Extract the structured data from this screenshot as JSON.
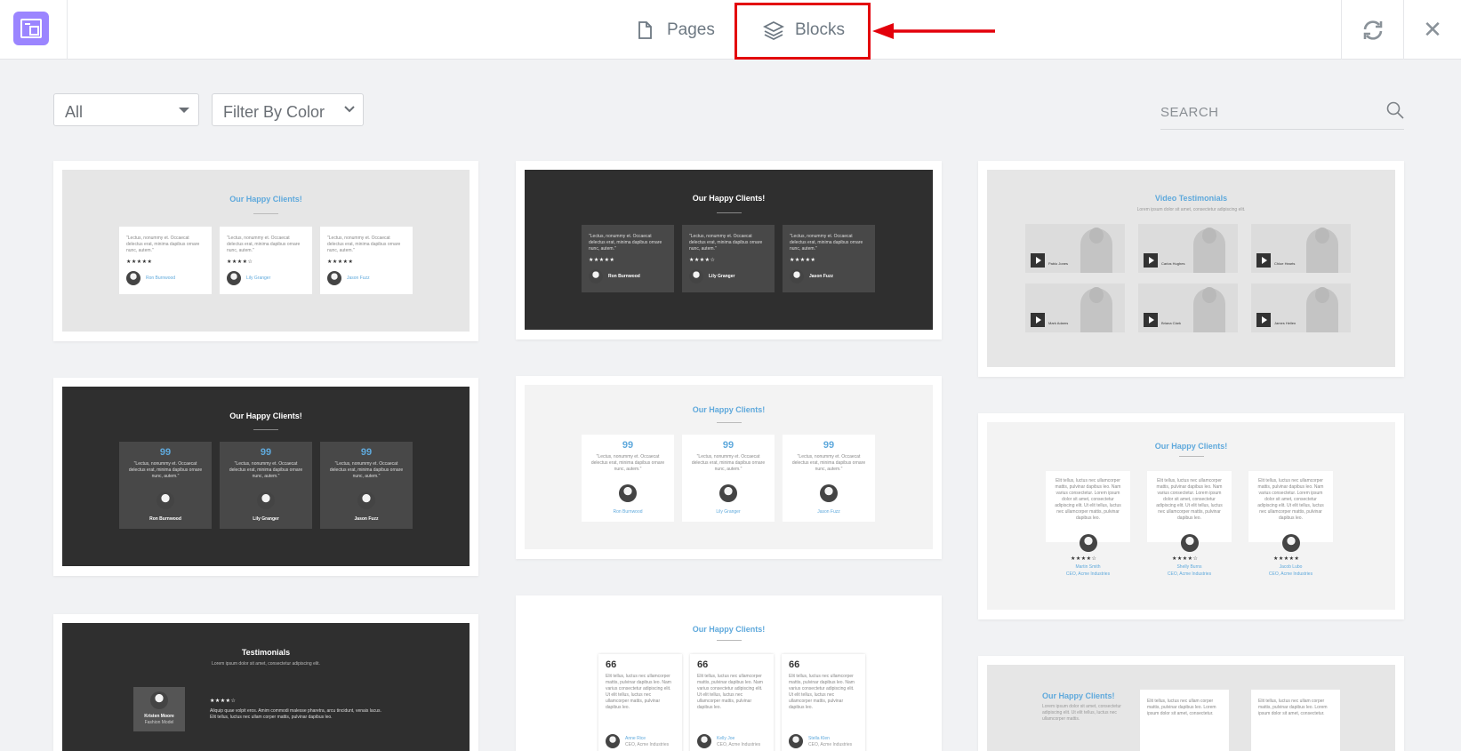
{
  "topbar": {
    "tabs": [
      {
        "label": "Pages",
        "icon": "file-icon"
      },
      {
        "label": "Blocks",
        "icon": "layers-icon",
        "active": true
      }
    ],
    "sync_icon": "sync-icon",
    "close_icon": "close-icon",
    "close_glyph": "✕",
    "highlight_color": "#e3000b",
    "logo_color": "#9b85ff"
  },
  "filters": {
    "category": "All",
    "color": "Filter By Color",
    "search_placeholder": "SEARCH"
  },
  "cards": [
    {
      "title": "Our Happy Clients!",
      "items": [
        {
          "text": "\"Lectus, nonummy et. Occaecat delectus erat, minima dapibus ornare nunc, autem.\"",
          "stars": "★★★★★",
          "name": "Ron Burnwood"
        },
        {
          "text": "\"Lectus, nonummy et. Occaecat delectus erat, minima dapibus ornare nunc, autem.\"",
          "stars": "★★★★☆",
          "name": "Lily Granger"
        },
        {
          "text": "\"Lectus, nonummy et. Occaecat delectus erat, minima dapibus ornare nunc, autem.\"",
          "stars": "★★★★★",
          "name": "Jason Fuzz"
        }
      ]
    },
    {
      "title": "Our Happy Clients!",
      "items": [
        {
          "text": "\"Lectus, nonummy et. Occaecat delectus erat, minima dapibus ornare nunc, autem.\"",
          "stars": "★★★★★",
          "name": "Ron Burnwood"
        },
        {
          "text": "\"Lectus, nonummy et. Occaecat delectus erat, minima dapibus ornare nunc, autem.\"",
          "stars": "★★★★☆",
          "name": "Lily Granger"
        },
        {
          "text": "\"Lectus, nonummy et. Occaecat delectus erat, minima dapibus ornare nunc, autem.\"",
          "stars": "★★★★★",
          "name": "Jason Fuzz"
        }
      ]
    },
    {
      "title": "Video Testimonials",
      "subtitle": "Lorem ipsum dolor sit amet, consectetur adipiscing elit.",
      "items": [
        {
          "name": "Pablo Jones",
          "role": "Student"
        },
        {
          "name": "Carlos Hughes",
          "role": "Student"
        },
        {
          "name": "Chloe Hearts",
          "role": "Student"
        },
        {
          "name": "Mark Adams",
          "role": "Student"
        },
        {
          "name": "Briana Clark",
          "role": "Student"
        },
        {
          "name": "James Hellen",
          "role": "Student"
        }
      ]
    },
    {
      "title": "Our Happy Clients!",
      "items": [
        {
          "text": "\"Lectus, nonummy et. Occaecat delectus erat, minima dapibus ornare nunc, autem.\"",
          "name": "Ron Burnwood"
        },
        {
          "text": "\"Lectus, nonummy et. Occaecat delectus erat, minima dapibus ornare nunc, autem.\"",
          "name": "Lily Granger"
        },
        {
          "text": "\"Lectus, nonummy et. Occaecat delectus erat, minima dapibus ornare nunc, autem.\"",
          "name": "Jason Fuzz"
        }
      ]
    },
    {
      "title": "Our Happy Clients!",
      "items": [
        {
          "text": "\"Lectus, nonummy et. Occaecat delectus erat, minima dapibus ornare nunc, autem.\"",
          "name": "Ron Burnwood"
        },
        {
          "text": "\"Lectus, nonummy et. Occaecat delectus erat, minima dapibus ornare nunc, autem.\"",
          "name": "Lily Granger"
        },
        {
          "text": "\"Lectus, nonummy et. Occaecat delectus erat, minima dapibus ornare nunc, autem.\"",
          "name": "Jason Fuzz"
        }
      ]
    },
    {
      "title": "Our Happy Clients!",
      "items": [
        {
          "text": "Elit tellus, luctus nec ullamcorper mattis, pulvinar dapibus leo. Nam varius consectetur. Lorem ipsum dolor sit amet, consectetur adipiscing elit. Ut elit tellus, luctus nec ullamcorper mattis, pulvinar dapibus leo.",
          "stars": "★★★★☆",
          "name": "Martin Smith",
          "role": "CEO, Acme Industries"
        },
        {
          "text": "Elit tellus, luctus nec ullamcorper mattis, pulvinar dapibus leo. Nam varius consectetur. Lorem ipsum dolor sit amet, consectetur adipiscing elit. Ut elit tellus, luctus nec ullamcorper mattis, pulvinar dapibus leo.",
          "stars": "★★★★☆",
          "name": "Shelly Burns",
          "role": "CEO, Acme Industries"
        },
        {
          "text": "Elit tellus, luctus nec ullamcorper mattis, pulvinar dapibus leo. Nam varius consectetur. Lorem ipsum dolor sit amet, consectetur adipiscing elit. Ut elit tellus, luctus nec ullamcorper mattis, pulvinar dapibus leo.",
          "stars": "★★★★★",
          "name": "Jacob Lubo",
          "role": "CEO, Acme Industries"
        }
      ]
    },
    {
      "title": "Testimonials",
      "subtitle": "Lorem ipsum dolor sit amet, consectetur adipiscing elit.",
      "person": {
        "name": "Kristen Moore",
        "role": "Fashion Model"
      },
      "stars": "★★★★☆",
      "text": "Aliquip quae volpit eros. Amim commodi malesse pharetra, arcu tincidunt, venais lacus. Elit tellus, luctus nec ullam corper mattis, pulvinar dapibus leo."
    },
    {
      "title": "Our Happy Clients!",
      "items": [
        {
          "text": "Elit tellus, luctus nec ullamcorper mattis, pulvinar dapibus leo. Nam varius consectetur adipiscing elit. Ut elit tellus, luctus nec ullamcorper mattis, pulvinar dapibus leo.",
          "name": "Anne Rice",
          "role": "CEO, Acme Industries"
        },
        {
          "text": "Elit tellus, luctus nec ullamcorper mattis, pulvinar dapibus leo. Nam varius consectetur adipiscing elit. Ut elit tellus, luctus nec ullamcorper mattis, pulvinar dapibus leo.",
          "name": "Kelly Joe",
          "role": "CEO, Acme Industries"
        },
        {
          "text": "Elit tellus, luctus nec ullamcorper mattis, pulvinar dapibus leo. Nam varius consectetur adipiscing elit. Ut elit tellus, luctus nec ullamcorper mattis, pulvinar dapibus leo.",
          "name": "Stella Klen",
          "role": "CEO, Acme Industries"
        }
      ]
    },
    {
      "title": "Our Happy Clients!",
      "subtitle": "Lorem ipsum dolor sit amet, consectetur adipiscing elit. Ut elit tellus, luctus nec ullamcorper mattis.",
      "items": [
        {
          "text": "Elit tellus, luctus nec ullam corper mattis, pulvinar dapibus leo. Lorem ipsum dolor sit amet, consectetur."
        },
        {
          "text": "Elit tellus, luctus nec ullam corper mattis, pulvinar dapibus leo. Lorem ipsum dolor sit amet, consectetur."
        }
      ]
    }
  ]
}
